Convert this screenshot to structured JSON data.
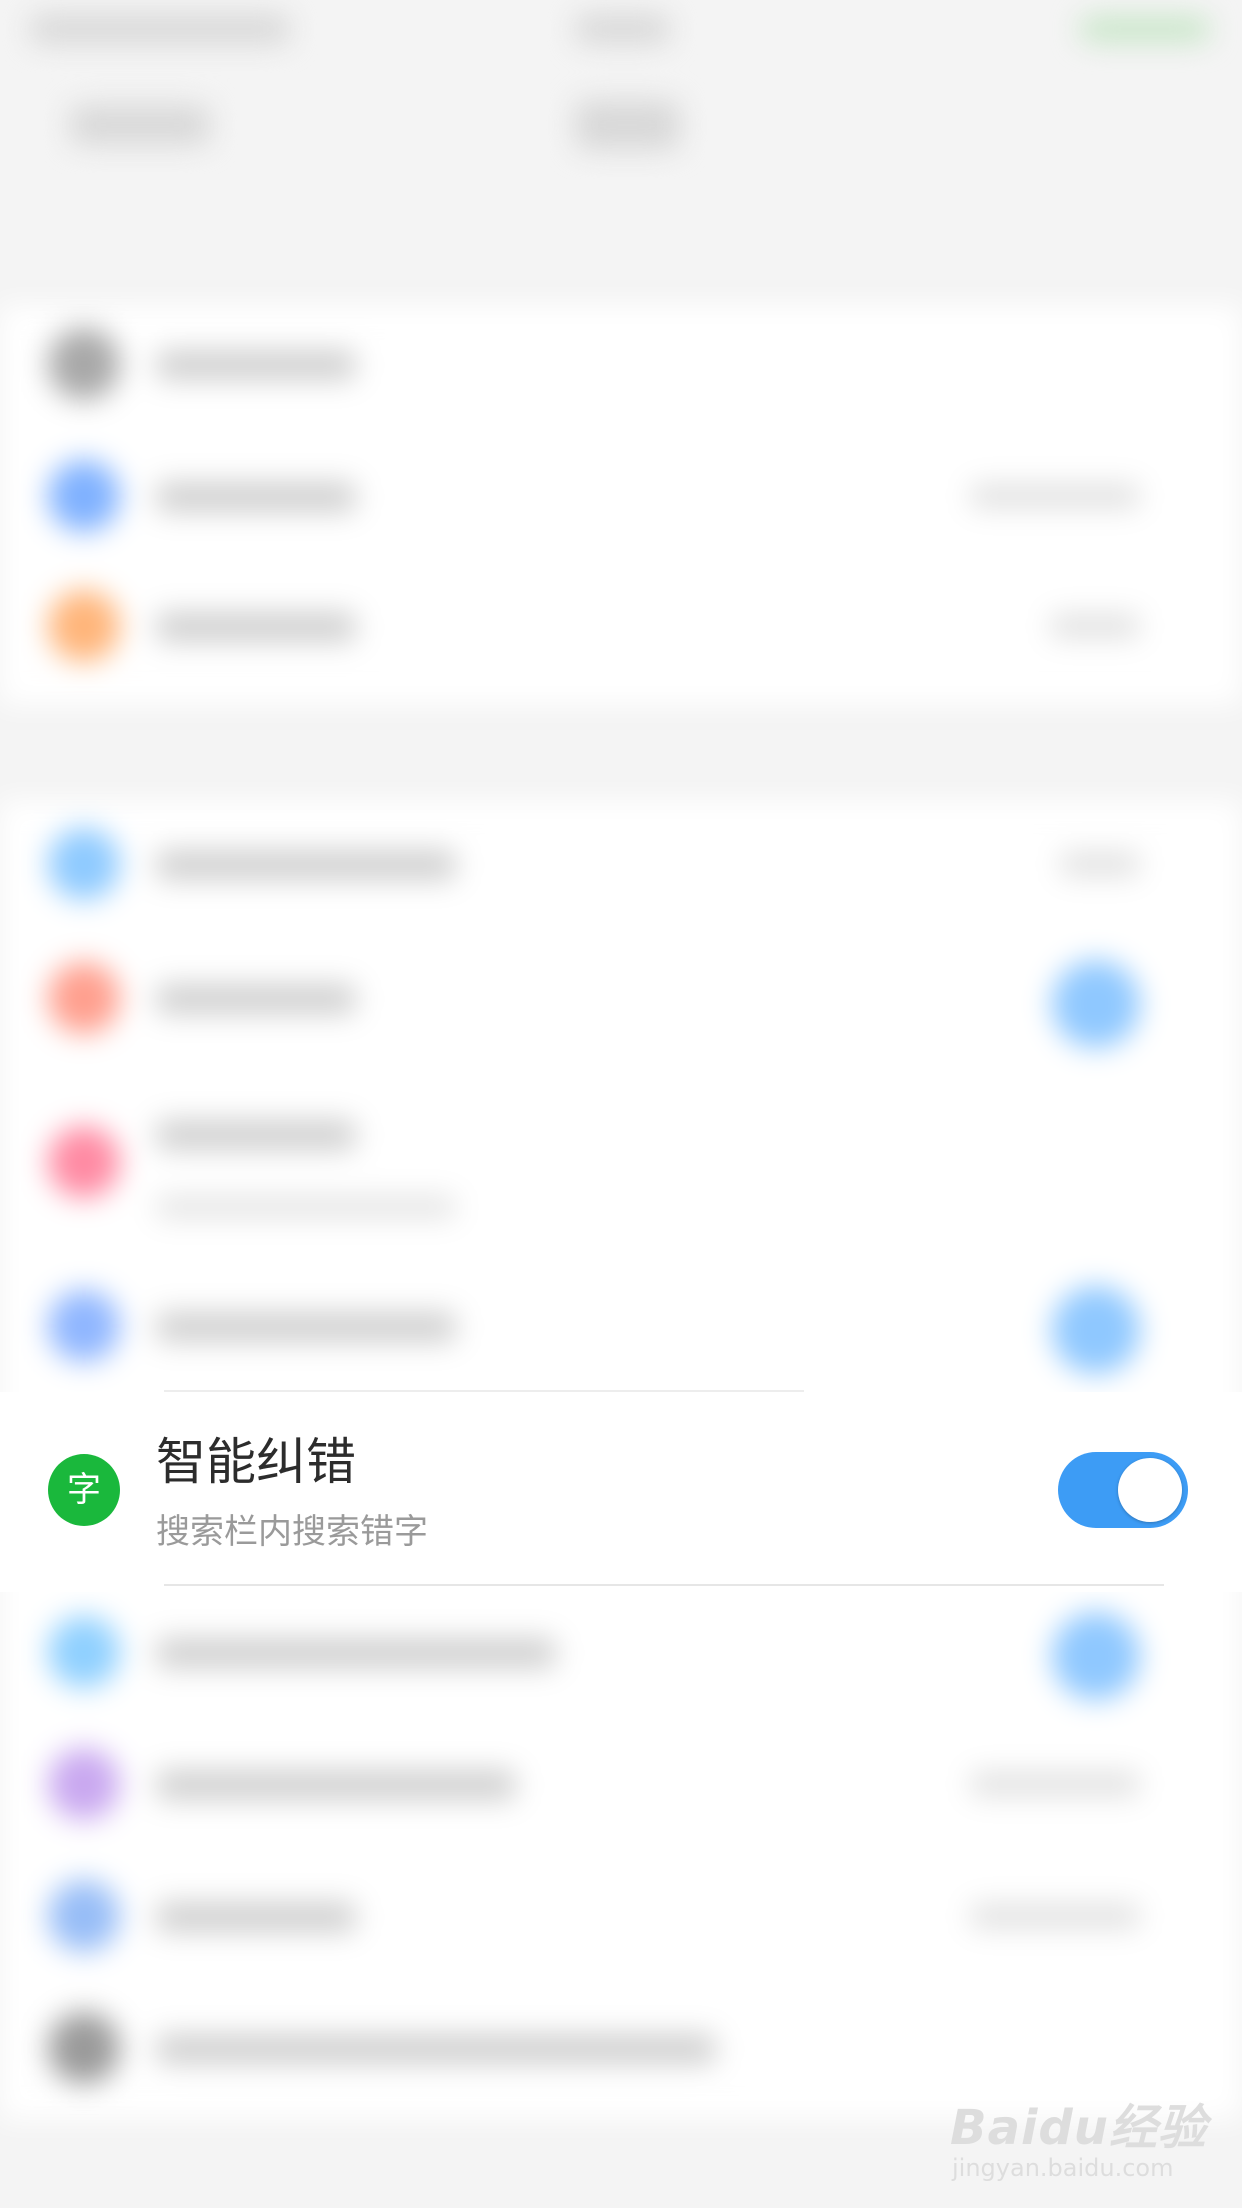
{
  "smart_correction": {
    "icon_glyph": "字",
    "icon_color": "#1ab83c",
    "title": "智能纠错",
    "subtitle": "搜索栏内搜索错字",
    "toggle_on": true,
    "toggle_color": "#3d9cf5"
  },
  "watermark": {
    "brand": "Baidu经验",
    "url": "jingyan.baidu.com"
  },
  "blurred_icon_colors": [
    "#a8a8a8",
    "#7fb1ff",
    "#ffb57a",
    "#8ecaff",
    "#ff9f8e",
    "#ff8aa3",
    "#8fb6ff",
    "#8fd0ff",
    "#c9a8f0",
    "#97bdf7",
    "#9a9a9a"
  ]
}
